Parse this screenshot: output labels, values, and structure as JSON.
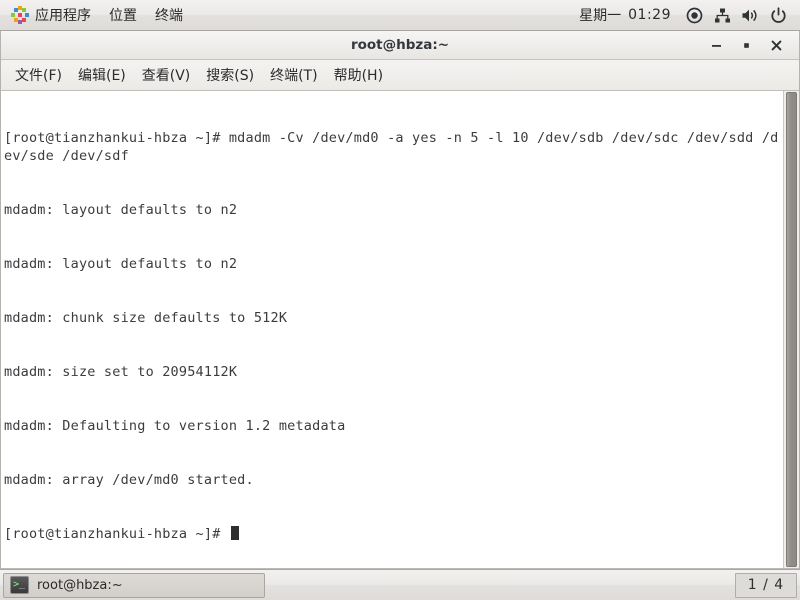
{
  "top_panel": {
    "apps_icon": "applications-pinwheel-icon",
    "menus": [
      {
        "label": "应用程序",
        "name": "applications-menu"
      },
      {
        "label": "位置",
        "name": "places-menu"
      },
      {
        "label": "终端",
        "name": "terminal-menu"
      }
    ],
    "clock": {
      "day": "星期一",
      "time": "01:29"
    },
    "tray": [
      {
        "name": "location-indicator-icon",
        "glyph": "target"
      },
      {
        "name": "network-icon",
        "glyph": "network"
      },
      {
        "name": "volume-icon",
        "glyph": "speaker"
      },
      {
        "name": "power-icon",
        "glyph": "power"
      }
    ]
  },
  "window": {
    "title": "root@hbza:~",
    "buttons": {
      "minimize": "–",
      "maximize": "▪",
      "close": "✕"
    },
    "menubar": [
      {
        "label": "文件(F)",
        "name": "menu-file"
      },
      {
        "label": "编辑(E)",
        "name": "menu-edit"
      },
      {
        "label": "查看(V)",
        "name": "menu-view"
      },
      {
        "label": "搜索(S)",
        "name": "menu-search"
      },
      {
        "label": "终端(T)",
        "name": "menu-terminal"
      },
      {
        "label": "帮助(H)",
        "name": "menu-help"
      }
    ]
  },
  "terminal": {
    "lines": [
      "[root@tianzhankui-hbza ~]# mdadm -Cv /dev/md0 -a yes -n 5 -l 10 /dev/sdb /dev/sdc /dev/sdd /dev/sde /dev/sdf",
      "mdadm: layout defaults to n2",
      "mdadm: layout defaults to n2",
      "mdadm: chunk size defaults to 512K",
      "mdadm: size set to 20954112K",
      "mdadm: Defaulting to version 1.2 metadata",
      "mdadm: array /dev/md0 started."
    ],
    "prompt": "[root@tianzhankui-hbza ~]# ",
    "foreground": "#3c3c3c",
    "background": "#ffffff"
  },
  "bottom_panel": {
    "task": {
      "label": "root@hbza:~",
      "icon": "terminal-icon"
    },
    "workspace": "1 / 4"
  }
}
